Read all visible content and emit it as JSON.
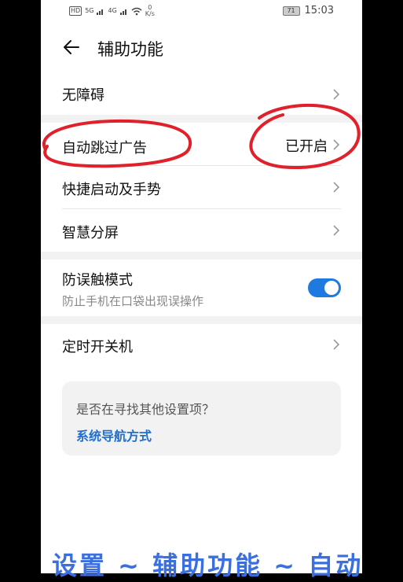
{
  "status_bar": {
    "hd": "HD",
    "net1": "5G",
    "net2": "4G",
    "speed_value": "0",
    "speed_unit": "K/s",
    "battery": "71",
    "time": "15:03"
  },
  "header": {
    "title": "辅助功能"
  },
  "settings": {
    "accessibility": "无障碍",
    "skip_ads": "自动跳过广告",
    "skip_ads_value": "已开启",
    "shortcuts": "快捷启动及手势",
    "split_screen": "智慧分屏",
    "mistouch": "防误触模式",
    "mistouch_desc": "防止手机在口袋出现误操作",
    "mistouch_on": true,
    "scheduled_power": "定时开关机"
  },
  "suggestion": {
    "question": "是否在寻找其他设置项？",
    "link": "系统导航方式"
  },
  "caption": "设置 ~ 辅助功能 ~ 自动",
  "colors": {
    "accent": "#1f7ae0",
    "annotation": "#e0202a",
    "caption": "#3b6fe0"
  }
}
